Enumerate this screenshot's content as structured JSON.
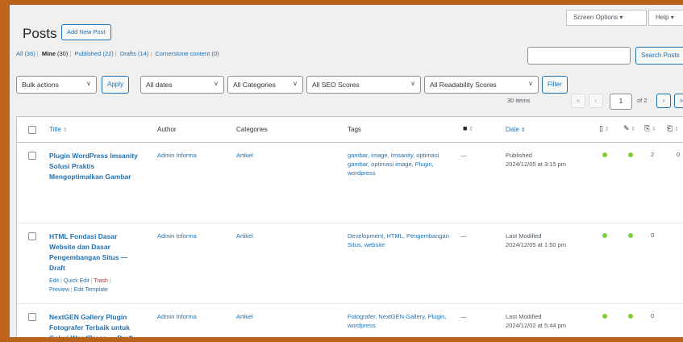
{
  "header": {
    "screen_options": "Screen Options",
    "help": "Help",
    "page_title": "Posts",
    "add_new": "Add New Post"
  },
  "views": [
    {
      "label": "All",
      "count": "(36)"
    },
    {
      "label": "Mine",
      "count": "(30)"
    },
    {
      "label": "Published",
      "count": "(22)"
    },
    {
      "label": "Drafts",
      "count": "(14)"
    },
    {
      "label": "Cornerstone content",
      "count": "(0)"
    }
  ],
  "search": {
    "placeholder": "",
    "button": "Search Posts"
  },
  "filters": {
    "bulk_actions": "Bulk actions",
    "apply": "Apply",
    "dates": "All dates",
    "categories": "All Categories",
    "seo": "All SEO Scores",
    "readability": "All Readability Scores",
    "filter": "Filter"
  },
  "pagination": {
    "items": "30 items",
    "first": "«",
    "prev": "‹",
    "current": "1",
    "of": "of 2",
    "next": "›",
    "last": "»"
  },
  "columns": {
    "title": "Title",
    "author": "Author",
    "categories": "Categories",
    "tags": "Tags",
    "date": "Date"
  },
  "icons": {
    "comments": "comment-icon",
    "seo": "seo-score-icon",
    "readability": "readability-icon",
    "links_out": "outgoing-links-icon",
    "links_in": "incoming-links-icon"
  },
  "rows": [
    {
      "title": "Plugin WordPress Imsanity Solusi Praktis Mengoptimalkan Gambar",
      "author": "Admin Informa",
      "category": "Artikel",
      "tags": "gambar, image, Imsanity, optimasi gambar, optimasi image, Plugin, wordpress",
      "comments": "—",
      "date_status": "Published",
      "date_value": "2024/12/05 at 3:15 pm",
      "links_out": "2",
      "links_in": "0"
    },
    {
      "title": "HTML Fondasi Dasar Website dan Dasar Pengembangan Situs — Draft",
      "author": "Admin Informa",
      "category": "Artikel",
      "tags": "Development, HTML, Pengembangan Situs, website",
      "comments": "—",
      "date_status": "Last Modified",
      "date_value": "2024/12/05 at 1:50 pm",
      "links_out": "0",
      "links_in": "",
      "row_actions": {
        "edit": "Edit",
        "quick_edit": "Quick Edit",
        "trash": "Trash",
        "preview": "Preview",
        "edit_template": "Edit Template"
      }
    },
    {
      "title": "NextGEN Gallery Plugin Fotografer Terbaik untuk Galeri WordPress — Draft",
      "author": "Admin Informa",
      "category": "Artikel",
      "tags": "Fotografer, NextGEN Gallery, Plugin, wordpress",
      "comments": "—",
      "date_status": "Last Modified",
      "date_value": "2024/12/02 at 5:44 pm",
      "links_out": "0",
      "links_in": ""
    }
  ],
  "colors": {
    "accent": "#2271b1",
    "seo_good": "#7ad03a",
    "trash": "#b32d2e",
    "frame": "#b8621a"
  }
}
